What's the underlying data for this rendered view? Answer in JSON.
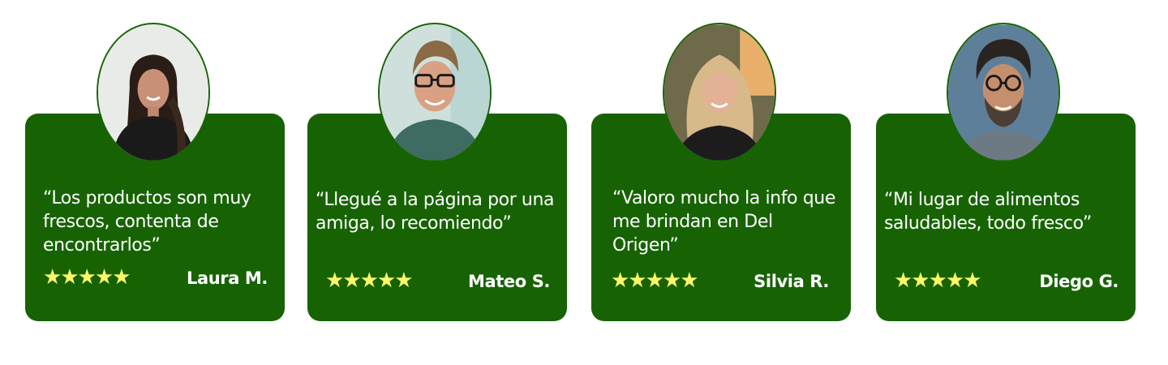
{
  "testimonials": [
    {
      "quote": "“Los productos son muy frescos, contenta de encontrarlos”",
      "stars": "★★★★★",
      "rating": 5,
      "name": "Laura M.",
      "avatar_icon": "woman-portrait"
    },
    {
      "quote": "“Llegué a la página por una amiga, lo recomiendo”",
      "stars": "★★★★★",
      "rating": 5,
      "name": "Mateo S.",
      "avatar_icon": "man-glasses-portrait"
    },
    {
      "quote": "“Valoro mucho la info que me brindan en Del Origen”",
      "stars": "★★★★★",
      "rating": 5,
      "name": "Silvia R.",
      "avatar_icon": "blonde-woman-portrait"
    },
    {
      "quote": "“Mi lugar de alimentos saludables, todo fresco”",
      "stars": "★★★★★",
      "rating": 5,
      "name": "Diego G.",
      "avatar_icon": "bearded-man-portrait"
    }
  ],
  "colors": {
    "card_background": "#176304",
    "star": "#fbf66a",
    "text": "#ffffff",
    "page_background": "#ffffff"
  }
}
